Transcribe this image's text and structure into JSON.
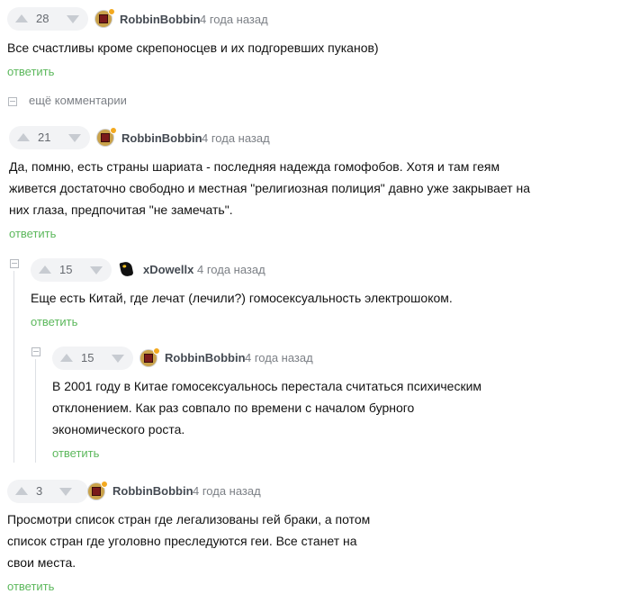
{
  "comments": [
    {
      "rating": "28",
      "author": "RobbinBobbin",
      "time": "4 года назад",
      "lines": [
        "Все счастливы кроме скрепоносцев и их подгоревших пуканов)"
      ],
      "reply": "ответить"
    },
    {
      "rating": "21",
      "author": "RobbinBobbin",
      "time": "4 года назад",
      "lines": [
        "Да, помню, есть страны шариата - последняя надежда гомофобов. Хотя и там геям",
        "живется достаточно свободно и местная \"религиозная полиция\" давно уже закрывает на",
        "них глаза, предпочитая \"не замечать\"."
      ],
      "reply": "ответить"
    },
    {
      "rating": "15",
      "author": "xDowellx",
      "time": "4 года назад",
      "lines": [
        "Еще есть Китай, где лечат (лечили?) гомосексуальность электрошоком."
      ],
      "reply": "ответить"
    },
    {
      "rating": "15",
      "author": "RobbinBobbin",
      "time": "4 года назад",
      "lines": [
        "В 2001 году в Китае гомосексуальнось перестала считаться психическим",
        "отклонением. Как раз совпало по времени с началом бурного",
        "экономического роста."
      ],
      "reply": "ответить"
    },
    {
      "rating": "3",
      "author": "RobbinBobbin",
      "time": "4 года назад",
      "lines": [
        "Просмотри список стран где легализованы гей браки, а потом",
        "список стран где уголовно преследуются геи. Все станет на",
        "свои места."
      ],
      "reply": "ответить"
    }
  ],
  "more_comments": "ещё комментарии",
  "colors": {
    "reply": "#5cb85c",
    "accent_dot": "#f3a91f",
    "avatar_red": "#7a1a1a"
  }
}
